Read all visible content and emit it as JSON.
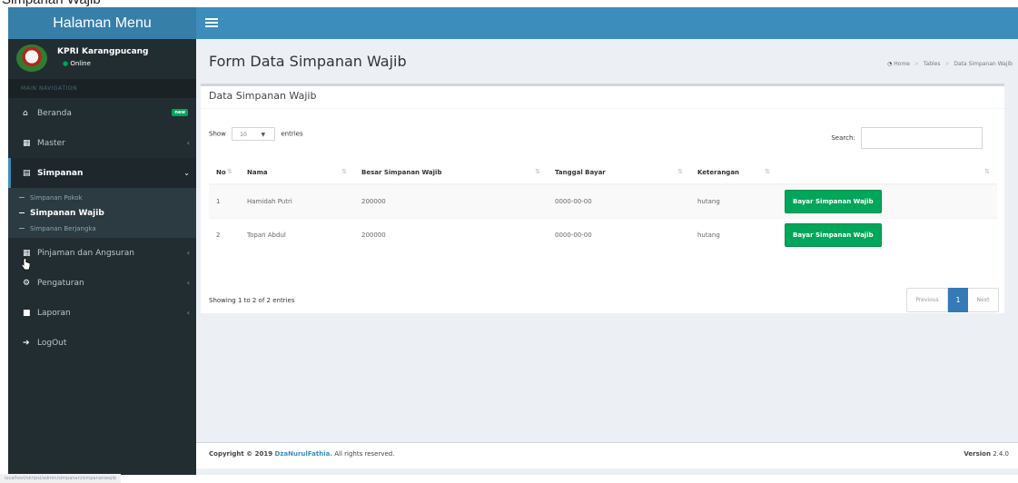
{
  "page_title_cut": "Simpanan Wajib",
  "app": {
    "logo_text": "Halaman Menu"
  },
  "user": {
    "name": "KPRI Karangpucang",
    "status": "Online"
  },
  "sidebar": {
    "header": "MAIN NAVIGATION",
    "items": [
      {
        "label": "Beranda",
        "icon": "home-icon",
        "badge": "new"
      },
      {
        "label": "Master",
        "icon": "book-icon"
      },
      {
        "label": "Simpanan",
        "icon": "list-icon"
      },
      {
        "label": "Pinjaman dan Angsuran",
        "icon": "table-icon"
      },
      {
        "label": "Pengaturan",
        "icon": "gears-icon"
      },
      {
        "label": "Laporan",
        "icon": "report-icon"
      },
      {
        "label": "LogOut",
        "icon": "signout-icon"
      }
    ],
    "submenu": [
      {
        "label": "Simpanan Pokok"
      },
      {
        "label": "Simpanan Wajib"
      },
      {
        "label": "Simpanan Berjangka"
      }
    ]
  },
  "content": {
    "title": "Form Data Simpanan Wajib",
    "breadcrumb": [
      "Home",
      "Tables",
      "Data Simpanan Wajib"
    ]
  },
  "box": {
    "title": "Data Simpanan Wajib",
    "show_label": "Show",
    "entries_value": "10",
    "entries_label": "entries",
    "search_label": "Search:",
    "search_value": "",
    "columns": [
      "No",
      "Nama",
      "Besar Simpanan Wajib",
      "Tanggal Bayar",
      "Keterangan",
      ""
    ],
    "rows": [
      {
        "no": "1",
        "nama": "Hamidah Putri",
        "besar": "200000",
        "tanggal": "0000-00-00",
        "ket": "hutang",
        "action": "Bayar Simpanan Wajib"
      },
      {
        "no": "2",
        "nama": "Topan Abdul",
        "besar": "200000",
        "tanggal": "0000-00-00",
        "ket": "hutang",
        "action": "Bayar Simpanan Wajib"
      }
    ],
    "info": "Showing 1 to 2 of 2 entries",
    "pager": {
      "prev": "Previous",
      "current": "1",
      "next": "Next"
    }
  },
  "footer": {
    "copyright_prefix": "Copyright © 2019 ",
    "brand": "DzaNurulFathia.",
    "suffix": " All rights reserved.",
    "version_label": "Version",
    "version_value": "2.4.0"
  },
  "status_url": "localhost/skripsi/admin/simpanan/simpananwajib"
}
